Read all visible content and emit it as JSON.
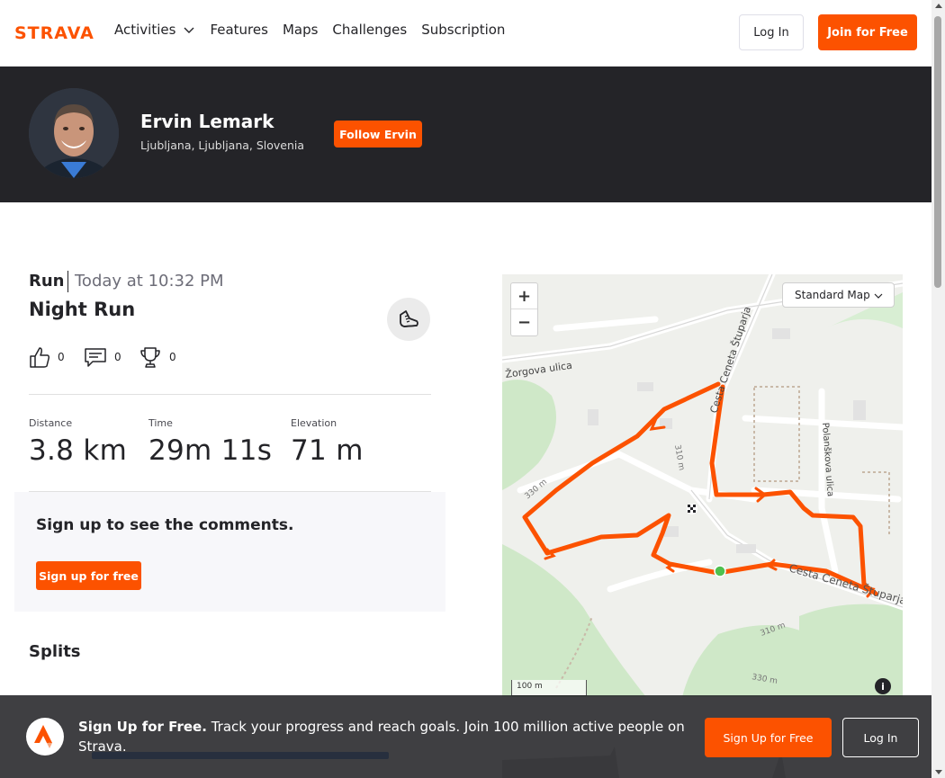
{
  "nav": {
    "logo_text": "STRAVA",
    "items": [
      {
        "label": "Activities",
        "has_dropdown": true
      },
      {
        "label": "Features"
      },
      {
        "label": "Maps"
      },
      {
        "label": "Challenges"
      },
      {
        "label": "Subscription"
      }
    ],
    "login_label": "Log In",
    "join_label": "Join for Free"
  },
  "athlete": {
    "name": "Ervin Lemark",
    "location": "Ljubljana, Ljubljana, Slovenia",
    "follow_label": "Follow Ervin"
  },
  "activity": {
    "type": "Run",
    "time": "Today at 10:32 PM",
    "title": "Night Run",
    "kudos_count": "0",
    "comments_count": "0",
    "achievements_count": "0",
    "stats": [
      {
        "label": "Distance",
        "value": "3.8 km"
      },
      {
        "label": "Time",
        "value": "29m 11s"
      },
      {
        "label": "Elevation",
        "value": "71 m"
      }
    ]
  },
  "comments": {
    "title": "Sign up to see the comments.",
    "button_label": "Sign up for free"
  },
  "splits": {
    "title": "Splits"
  },
  "map": {
    "type_label": "Standard Map",
    "zoom_in": "+",
    "zoom_out": "−",
    "scale_label": "100 m",
    "street_labels": [
      "Cesta Ceneta Štuparja",
      "Žorgova ulica",
      "Polanškova ulica",
      "Cesta Ceneta Štuparja"
    ],
    "contour_labels": [
      "310 m",
      "330 m",
      "310 m",
      "330 m"
    ],
    "info_label": "i"
  },
  "banner": {
    "headline": "Sign Up for Free.",
    "message": "Track your progress and reach goals. Join 100 million active people on Strava.",
    "signup_label": "Sign Up for Free",
    "login_label": "Log In"
  },
  "colors": {
    "brand": "#fc5200",
    "dark": "#242428",
    "route": "#fc5200",
    "start_marker": "#4fc04f"
  }
}
